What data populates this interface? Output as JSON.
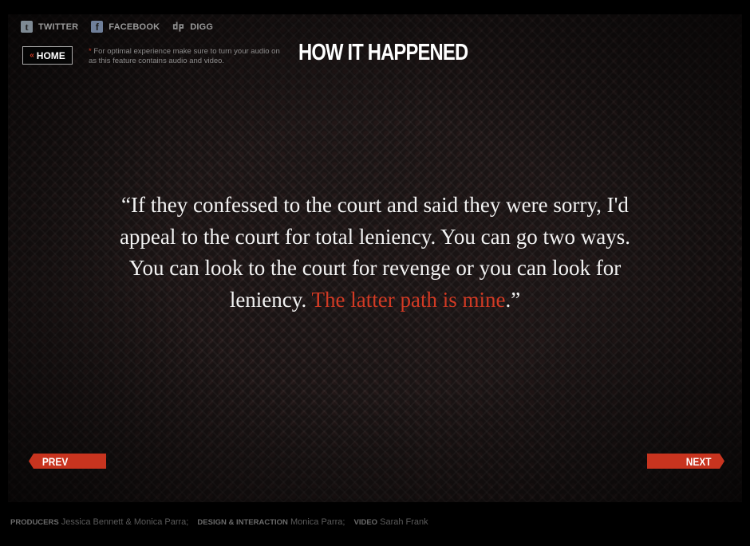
{
  "social": {
    "twitter": {
      "label": "TWITTER",
      "icon": "twitter-icon"
    },
    "facebook": {
      "label": "FACEBOOK",
      "icon": "facebook-icon"
    },
    "digg": {
      "label": "DIGG",
      "icon": "digg-icon"
    }
  },
  "home": {
    "chevron": "«",
    "label": "HOME"
  },
  "notice": {
    "star": "*",
    "text": "For optimal experience make sure to turn your audio on as this feature contains audio and video."
  },
  "title": "HOW IT HAPPENED",
  "quote": {
    "main": "“If they confessed to the court and said they were sorry, I'd appeal to the court for total leniency. You can go two ways. You can look to the court for revenge or you can look for leniency. ",
    "highlight": "The latter path is mine",
    "end": ".”"
  },
  "nav": {
    "prev": "PREV",
    "next": "NEXT"
  },
  "credits": {
    "producers_role": "PRODUCERS",
    "producers": "Jessica Bennett & Monica Parra;",
    "design_role": "DESIGN & INTERACTION",
    "design": "Monica Parra;",
    "video_role": "VIDEO",
    "video": "Sarah Frank"
  },
  "colors": {
    "accent": "#d23a24",
    "background": "#1a1414",
    "text": "#f2f2f2"
  }
}
